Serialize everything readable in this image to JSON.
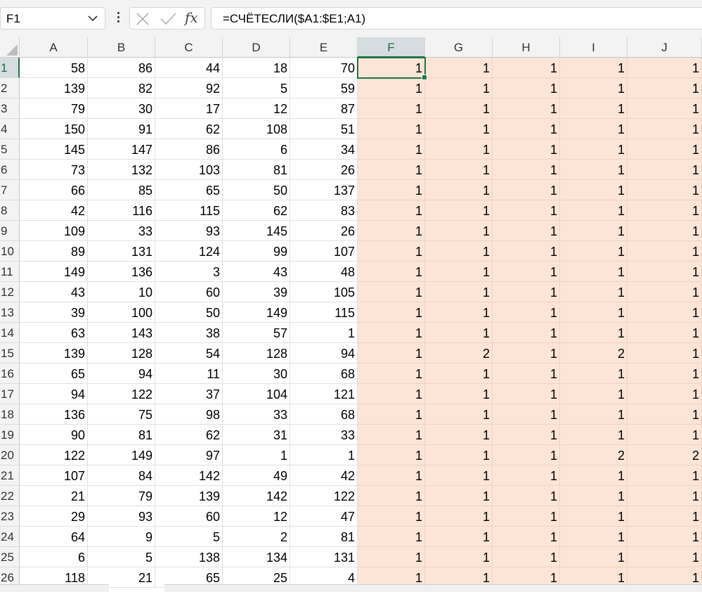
{
  "formula_bar": {
    "name_box": "F1",
    "formula": "=СЧЁТЕСЛИ($A1:$E1;A1)",
    "fx_label": "fx"
  },
  "active_cell": "F1",
  "columns": [
    "A",
    "B",
    "C",
    "D",
    "E",
    "F",
    "G",
    "H",
    "I",
    "J"
  ],
  "selected_column": "F",
  "rows": [
    {
      "n": "1",
      "v": [
        "58",
        "86",
        "44",
        "18",
        "70",
        "1",
        "1",
        "1",
        "1",
        "1"
      ]
    },
    {
      "n": "2",
      "v": [
        "139",
        "82",
        "92",
        "5",
        "59",
        "1",
        "1",
        "1",
        "1",
        "1"
      ]
    },
    {
      "n": "3",
      "v": [
        "79",
        "30",
        "17",
        "12",
        "87",
        "1",
        "1",
        "1",
        "1",
        "1"
      ]
    },
    {
      "n": "4",
      "v": [
        "150",
        "91",
        "62",
        "108",
        "51",
        "1",
        "1",
        "1",
        "1",
        "1"
      ]
    },
    {
      "n": "5",
      "v": [
        "145",
        "147",
        "86",
        "6",
        "34",
        "1",
        "1",
        "1",
        "1",
        "1"
      ]
    },
    {
      "n": "6",
      "v": [
        "73",
        "132",
        "103",
        "81",
        "26",
        "1",
        "1",
        "1",
        "1",
        "1"
      ]
    },
    {
      "n": "7",
      "v": [
        "66",
        "85",
        "65",
        "50",
        "137",
        "1",
        "1",
        "1",
        "1",
        "1"
      ]
    },
    {
      "n": "8",
      "v": [
        "42",
        "116",
        "115",
        "62",
        "83",
        "1",
        "1",
        "1",
        "1",
        "1"
      ]
    },
    {
      "n": "9",
      "v": [
        "109",
        "33",
        "93",
        "145",
        "26",
        "1",
        "1",
        "1",
        "1",
        "1"
      ]
    },
    {
      "n": "10",
      "v": [
        "89",
        "131",
        "124",
        "99",
        "107",
        "1",
        "1",
        "1",
        "1",
        "1"
      ]
    },
    {
      "n": "11",
      "v": [
        "149",
        "136",
        "3",
        "43",
        "48",
        "1",
        "1",
        "1",
        "1",
        "1"
      ]
    },
    {
      "n": "12",
      "v": [
        "43",
        "10",
        "60",
        "39",
        "105",
        "1",
        "1",
        "1",
        "1",
        "1"
      ]
    },
    {
      "n": "13",
      "v": [
        "39",
        "100",
        "50",
        "149",
        "115",
        "1",
        "1",
        "1",
        "1",
        "1"
      ]
    },
    {
      "n": "14",
      "v": [
        "63",
        "143",
        "38",
        "57",
        "1",
        "1",
        "1",
        "1",
        "1",
        "1"
      ]
    },
    {
      "n": "15",
      "v": [
        "139",
        "128",
        "54",
        "128",
        "94",
        "1",
        "2",
        "1",
        "2",
        "1"
      ]
    },
    {
      "n": "16",
      "v": [
        "65",
        "94",
        "11",
        "30",
        "68",
        "1",
        "1",
        "1",
        "1",
        "1"
      ]
    },
    {
      "n": "17",
      "v": [
        "94",
        "122",
        "37",
        "104",
        "121",
        "1",
        "1",
        "1",
        "1",
        "1"
      ]
    },
    {
      "n": "18",
      "v": [
        "136",
        "75",
        "98",
        "33",
        "68",
        "1",
        "1",
        "1",
        "1",
        "1"
      ]
    },
    {
      "n": "19",
      "v": [
        "90",
        "81",
        "62",
        "31",
        "33",
        "1",
        "1",
        "1",
        "1",
        "1"
      ]
    },
    {
      "n": "20",
      "v": [
        "122",
        "149",
        "97",
        "1",
        "1",
        "1",
        "1",
        "1",
        "2",
        "2"
      ]
    },
    {
      "n": "21",
      "v": [
        "107",
        "84",
        "142",
        "49",
        "42",
        "1",
        "1",
        "1",
        "1",
        "1"
      ]
    },
    {
      "n": "22",
      "v": [
        "21",
        "79",
        "139",
        "142",
        "122",
        "1",
        "1",
        "1",
        "1",
        "1"
      ]
    },
    {
      "n": "23",
      "v": [
        "29",
        "93",
        "60",
        "12",
        "47",
        "1",
        "1",
        "1",
        "1",
        "1"
      ]
    },
    {
      "n": "24",
      "v": [
        "64",
        "9",
        "5",
        "2",
        "81",
        "1",
        "1",
        "1",
        "1",
        "1"
      ]
    },
    {
      "n": "25",
      "v": [
        "6",
        "5",
        "138",
        "134",
        "131",
        "1",
        "1",
        "1",
        "1",
        "1"
      ]
    },
    {
      "n": "26",
      "v": [
        "118",
        "21",
        "65",
        "25",
        "4",
        "1",
        "1",
        "1",
        "1",
        "1"
      ]
    }
  ],
  "colors": {
    "accent": "#217346",
    "result_fill": "#fce4d6",
    "header_bg": "#f3f3f3"
  }
}
